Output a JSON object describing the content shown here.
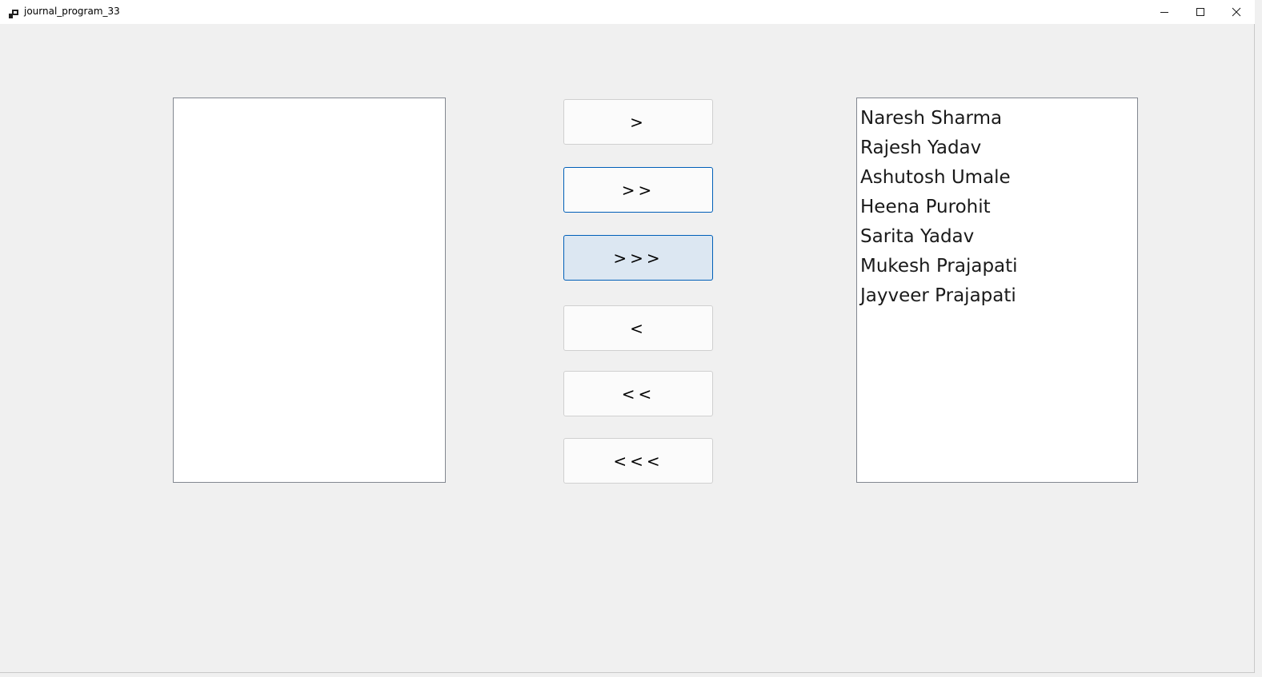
{
  "window": {
    "title": "journal_program_33"
  },
  "left_list": {
    "items": []
  },
  "buttons": {
    "move_one_right": ">",
    "move_two_right": ">>",
    "move_all_right": ">>>",
    "move_one_left": "<",
    "move_two_left": "<<",
    "move_all_left": "<<<"
  },
  "right_list": {
    "items": [
      "Naresh Sharma",
      "Rajesh Yadav",
      "Ashutosh Umale",
      "Heena Purohit",
      "Sarita Yadav",
      "Mukesh Prajapati",
      "Jayveer Prajapati"
    ]
  },
  "icons": {
    "app": "app-icon",
    "minimize": "minimize-icon",
    "maximize": "maximize-icon",
    "close": "close-icon"
  }
}
